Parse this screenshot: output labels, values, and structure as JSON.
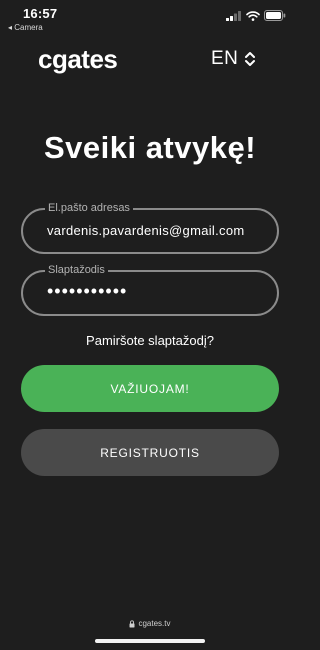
{
  "status_bar": {
    "time": "16:57",
    "back_app": "◂ Camera",
    "icons": [
      "signal-icon",
      "wifi-icon",
      "battery-icon"
    ]
  },
  "header": {
    "logo": "cgates",
    "language": "EN",
    "language_icon": "chevron-updown-icon"
  },
  "title": "Sveiki atvykę!",
  "form": {
    "email": {
      "label": "El.pašto adresas",
      "value": "vardenis.pavardenis@gmail.com"
    },
    "password": {
      "label": "Slaptažodis",
      "value": "•••••••••••"
    },
    "forgot_link": "Pamiršote slaptažodį?"
  },
  "buttons": {
    "login": "VAŽIUOJAM!",
    "register": "REGISTRUOTIS"
  },
  "footer": {
    "url": "cgates.tv",
    "url_icon": "lock-icon"
  },
  "colors": {
    "background": "#1e1e1e",
    "primary_button": "#4ab257",
    "secondary_button": "#4a4a4a",
    "field_border": "#8b8b8b"
  }
}
